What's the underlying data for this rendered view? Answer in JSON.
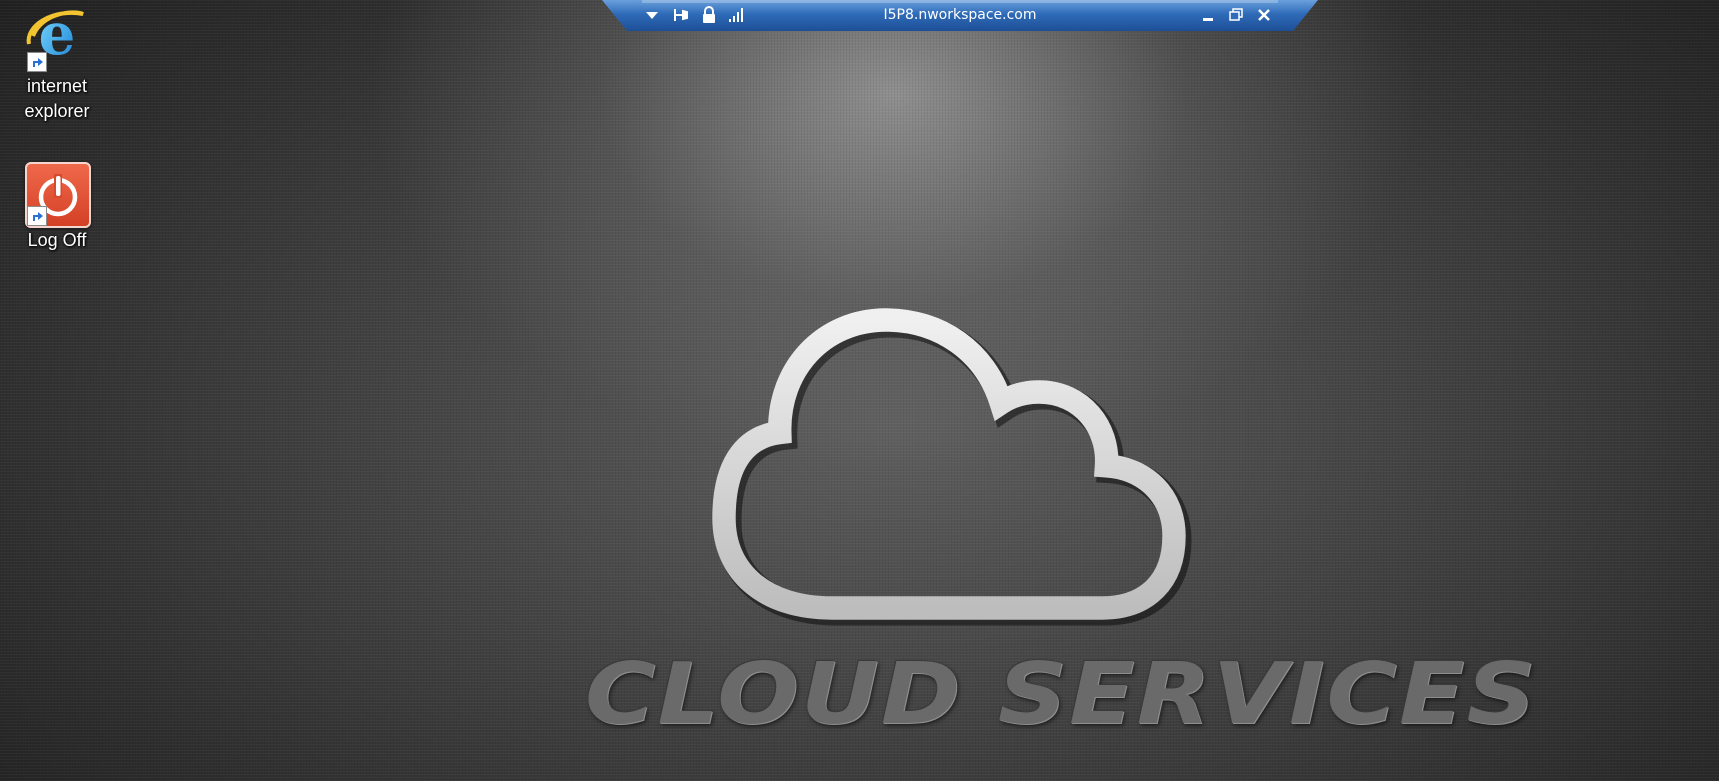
{
  "desktop": {
    "icons": [
      {
        "label_line1": "internet",
        "label_line2": "explorer",
        "icon": "internet-explorer-icon"
      },
      {
        "label": "Log Off",
        "icon": "power-icon"
      }
    ]
  },
  "connection_bar": {
    "host": "I5P8.nworkspace.com",
    "color": "#2f6bb8",
    "buttons": {
      "menu": "chevron-down-icon",
      "pin": "pin-icon",
      "lock": "lock-icon",
      "signal": "signal-strength-icon",
      "minimize": "minimize-icon",
      "restore": "restore-icon",
      "close": "close-icon"
    }
  },
  "wallpaper": {
    "text": "CLOUD SERVICES",
    "art": "cloud-icon"
  }
}
